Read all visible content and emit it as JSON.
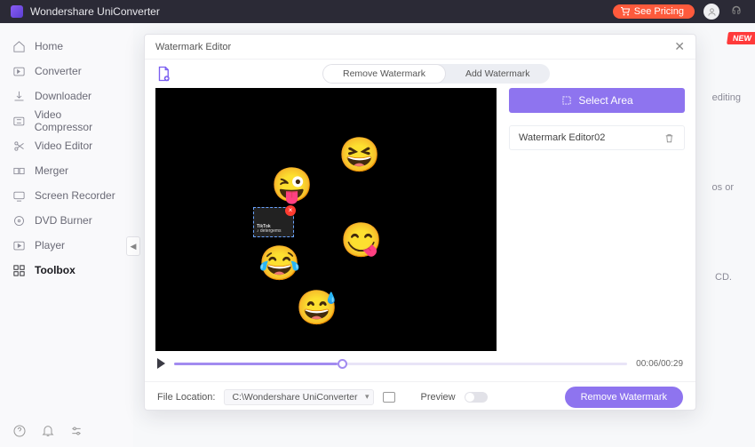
{
  "app": {
    "title": "Wondershare UniConverter",
    "pricing": "See Pricing"
  },
  "sidebar": {
    "items": [
      {
        "label": "Home"
      },
      {
        "label": "Converter"
      },
      {
        "label": "Downloader"
      },
      {
        "label": "Video Compressor"
      },
      {
        "label": "Video Editor"
      },
      {
        "label": "Merger"
      },
      {
        "label": "Screen Recorder"
      },
      {
        "label": "DVD Burner"
      },
      {
        "label": "Player"
      },
      {
        "label": "Toolbox"
      }
    ]
  },
  "badges": {
    "new": "NEW"
  },
  "bg": {
    "t1": "editing",
    "t2": "os or",
    "t3": "CD."
  },
  "modal": {
    "title": "Watermark Editor",
    "tabs": {
      "remove": "Remove Watermark",
      "add": "Add Watermark"
    },
    "select_area": "Select Area",
    "item": "Watermark Editor02",
    "wm_small": "♪ detergems",
    "wm_brand": "TikTok",
    "time": "00:06/00:29",
    "file_location_label": "File Location:",
    "file_location_value": "C:\\Wondershare UniConverter",
    "preview_label": "Preview",
    "remove_btn": "Remove Watermark"
  }
}
